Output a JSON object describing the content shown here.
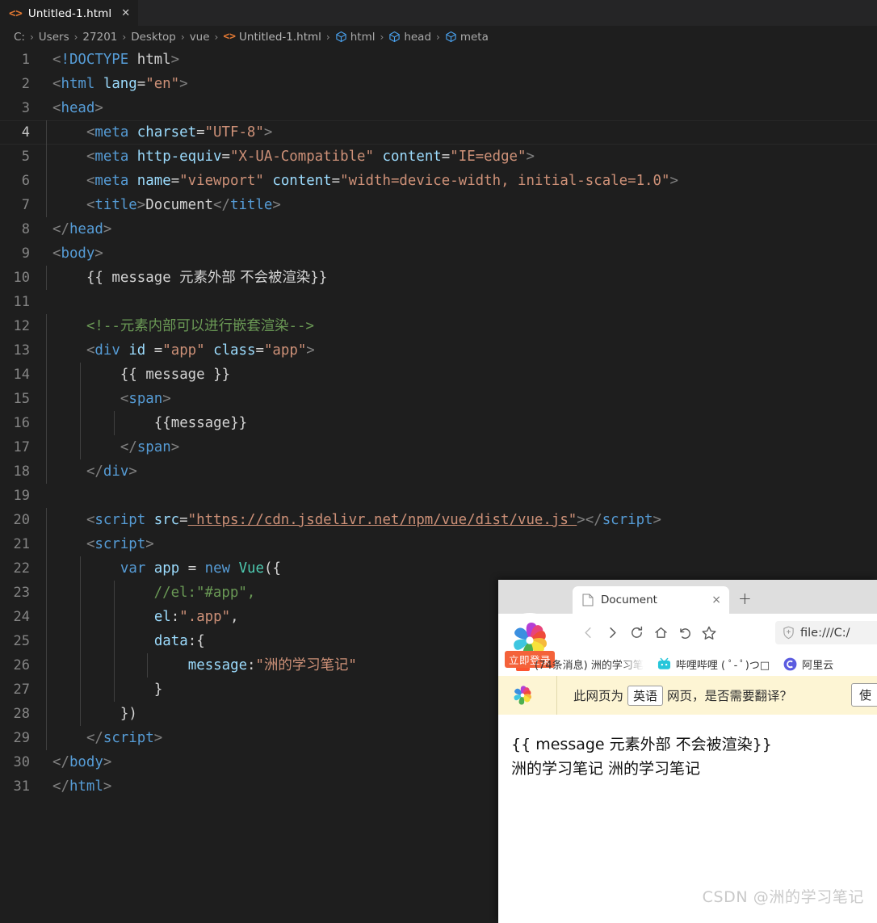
{
  "editor": {
    "tab": {
      "label": "Untitled-1.html",
      "icon": "html-file-icon",
      "close": "✕"
    },
    "breadcrumb": [
      {
        "label": "C:",
        "icon": ""
      },
      {
        "label": "Users",
        "icon": ""
      },
      {
        "label": "27201",
        "icon": ""
      },
      {
        "label": "Desktop",
        "icon": ""
      },
      {
        "label": "vue",
        "icon": ""
      },
      {
        "label": "Untitled-1.html",
        "icon": "html-file-icon"
      },
      {
        "label": "html",
        "icon": "symbol-cube-icon"
      },
      {
        "label": "head",
        "icon": "symbol-cube-icon"
      },
      {
        "label": "meta",
        "icon": "symbol-cube-icon"
      }
    ],
    "separator": "›",
    "active_line": 4,
    "lines": [
      {
        "n": "1",
        "text": "<!DOCTYPE html>"
      },
      {
        "n": "2",
        "text": "<html lang=\"en\">"
      },
      {
        "n": "3",
        "text": "<head>"
      },
      {
        "n": "4",
        "text": "    <meta charset=\"UTF-8\">"
      },
      {
        "n": "5",
        "text": "    <meta http-equiv=\"X-UA-Compatible\" content=\"IE=edge\">"
      },
      {
        "n": "6",
        "text": "    <meta name=\"viewport\" content=\"width=device-width, initial-scale=1.0\">"
      },
      {
        "n": "7",
        "text": "    <title>Document</title>"
      },
      {
        "n": "8",
        "text": "</head>"
      },
      {
        "n": "9",
        "text": "<body>"
      },
      {
        "n": "10",
        "text": "    {{ message 元素外部 不会被渲染}}"
      },
      {
        "n": "11",
        "text": ""
      },
      {
        "n": "12",
        "text": "    <!--元素内部可以进行嵌套渲染-->"
      },
      {
        "n": "13",
        "text": "    <div id =\"app\" class=\"app\">"
      },
      {
        "n": "14",
        "text": "        {{ message }}"
      },
      {
        "n": "15",
        "text": "        <span>"
      },
      {
        "n": "16",
        "text": "            {{message}}"
      },
      {
        "n": "17",
        "text": "        </span>"
      },
      {
        "n": "18",
        "text": "    </div>"
      },
      {
        "n": "19",
        "text": ""
      },
      {
        "n": "20",
        "text": "    <script src=\"https://cdn.jsdelivr.net/npm/vue/dist/vue.js\"></script>"
      },
      {
        "n": "21",
        "text": "    <script>"
      },
      {
        "n": "22",
        "text": "        var app = new Vue({"
      },
      {
        "n": "23",
        "text": "            //el:\"#app\","
      },
      {
        "n": "24",
        "text": "            el:\".app\","
      },
      {
        "n": "25",
        "text": "            data:{"
      },
      {
        "n": "26",
        "text": "                message:\"洲的学习笔记\""
      },
      {
        "n": "27",
        "text": "            }"
      },
      {
        "n": "28",
        "text": "        })"
      },
      {
        "n": "29",
        "text": "    </script>"
      },
      {
        "n": "30",
        "text": "</body>"
      },
      {
        "n": "31",
        "text": "</html>"
      }
    ]
  },
  "browser": {
    "name": "360-browser",
    "logo": "360-pinwheel-icon",
    "login_badge": "立即登录",
    "tab": {
      "title": "Document",
      "icon": "page-icon",
      "close": "×"
    },
    "new_tab": "+",
    "nav": {
      "back": "‹",
      "forward": "›",
      "reload": "reload-icon",
      "home": "home-icon",
      "undo": "undo-icon",
      "favorite": "star-icon"
    },
    "address": {
      "value": "file:///C:/",
      "security_icon": "shield-icon"
    },
    "bookmarks": [
      {
        "label": "(74条消息) 洲的学习笔",
        "icon": "csdn-icon",
        "icon_text": "C",
        "color": "#fc5531"
      },
      {
        "label": "哔哩哔哩 ( ﾟ- ﾟ)つ□",
        "icon": "bilibili-icon",
        "icon_text": "",
        "color": "#26c6da"
      },
      {
        "label": "阿里云",
        "icon": "aliyun-icon",
        "icon_text": "",
        "color": "#5b5ce0"
      }
    ],
    "translate_bar": {
      "icon": "360-pinwheel-icon",
      "prefix": "此网页为",
      "language": "英语",
      "suffix": "网页，是否需要翻译？",
      "button": "使"
    },
    "page_content": [
      "{{ message 元素外部 不会被渲染}}",
      "洲的学习笔记 洲的学习笔记"
    ]
  },
  "watermark": "CSDN @洲的学习笔记"
}
